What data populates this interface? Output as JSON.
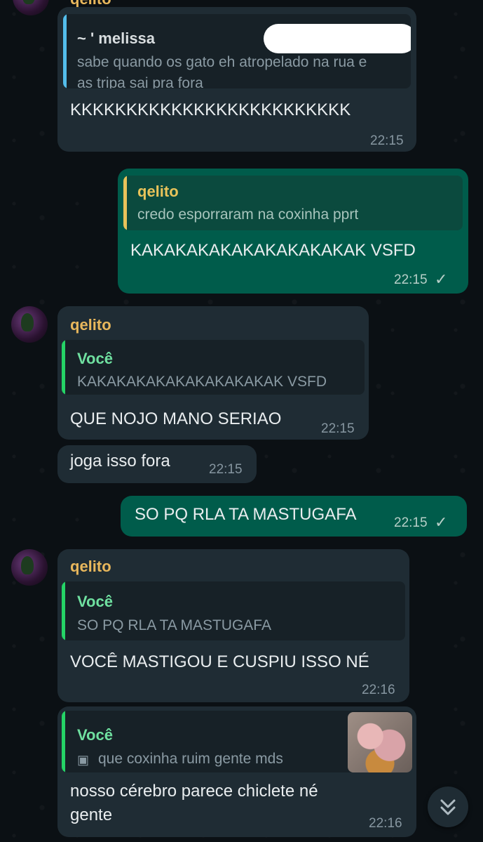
{
  "messages": [
    {
      "quote_author": "~ ' melissa",
      "quote_text": "sabe quando os gato eh atropelado na rua e as tripa sai pra fora",
      "text": "KKKKKKKKKKKKKKKKKKKKKKKKK",
      "time": "22:15"
    },
    {
      "quote_author": "qelito",
      "quote_text": "credo esporraram na coxinha pprt",
      "text": "KAKAKAKAKAKAKAKAKAKAK VSFD",
      "time": "22:15"
    },
    {
      "sender": "qelito",
      "quote_author": "Você",
      "quote_text": "KAKAKAKAKAKAKAKAKAKAK VSFD",
      "text": "QUE NOJO MANO SERIAO",
      "time": "22:15"
    },
    {
      "text": "joga isso fora",
      "time": "22:15"
    },
    {
      "text": "SO PQ RLA TA MASTUGAFA",
      "time": "22:15"
    },
    {
      "sender": "qelito",
      "quote_author": "Você",
      "quote_text": "SO PQ RLA TA MASTUGAFA",
      "text": "VOCÊ MASTIGOU E CUSPIU ISSO NÉ",
      "time": "22:16"
    },
    {
      "quote_author": "Você",
      "quote_text": "que coxinha ruim gente mds",
      "text_line1": "nosso cérebro parece chiclete né",
      "text_line2": "gente",
      "time": "22:16"
    }
  ],
  "colors": {
    "incoming": "#1f2c34",
    "outgoing": "#005c4b",
    "sender": "#e8b75c",
    "quote_you": "#53bdeb",
    "quote_green": "#25d366"
  }
}
